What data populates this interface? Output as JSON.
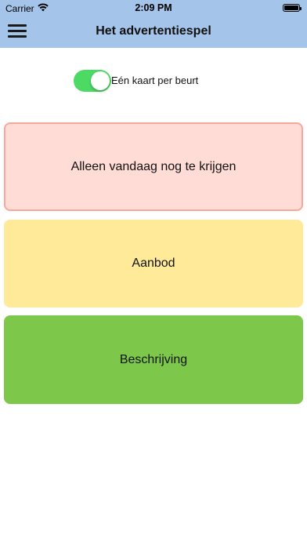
{
  "statusbar": {
    "carrier": "Carrier",
    "time": "2:09 PM",
    "wifi_icon": "wifi-icon",
    "battery_icon": "battery-icon"
  },
  "header": {
    "title": "Het advertentiespel",
    "menu_icon": "hamburger-menu-icon",
    "background": "#a4c4ea"
  },
  "toggle": {
    "label": "Eén kaart per beurt",
    "checked": true,
    "color": "#4cd964"
  },
  "cards": [
    {
      "label": "Alleen vandaag nog te krijgen",
      "color": "#ffdcd5",
      "border": "#f7a899"
    },
    {
      "label": "Aanbod",
      "color": "#ffea99"
    },
    {
      "label": "Beschrijving",
      "color": "#7dc84a"
    }
  ]
}
